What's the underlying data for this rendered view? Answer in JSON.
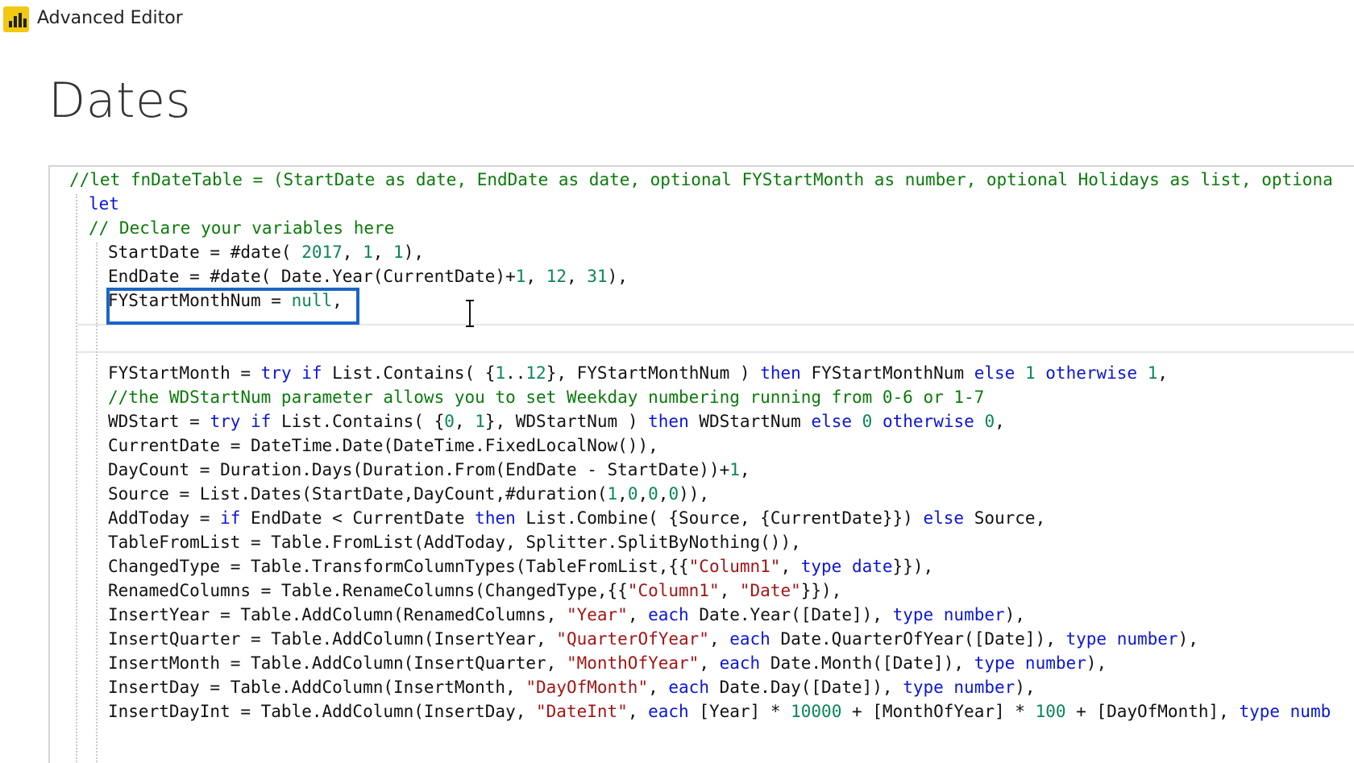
{
  "window": {
    "title": "Advanced Editor",
    "app_icon": "power-bi-icon"
  },
  "query": {
    "name": "Dates"
  },
  "editor": {
    "lines": [
      {
        "indent": 0,
        "segments": [
          {
            "t": "cm",
            "v": "//let fnDateTable = (StartDate as date, EndDate as date, optional FYStartMonth as number, optional Holidays as list, optiona"
          }
        ]
      },
      {
        "indent": 1,
        "segments": [
          {
            "t": "kw",
            "v": "let"
          }
        ]
      },
      {
        "indent": 1,
        "segments": [
          {
            "t": "cm",
            "v": "// Declare your variables here"
          }
        ]
      },
      {
        "indent": 2,
        "segments": [
          {
            "t": "",
            "v": "StartDate = #date( "
          },
          {
            "t": "num",
            "v": "2017"
          },
          {
            "t": "",
            "v": ", "
          },
          {
            "t": "num",
            "v": "1"
          },
          {
            "t": "",
            "v": ", "
          },
          {
            "t": "num",
            "v": "1"
          },
          {
            "t": "",
            "v": "),"
          }
        ]
      },
      {
        "indent": 2,
        "segments": [
          {
            "t": "",
            "v": "EndDate = #date( Date.Year(CurrentDate)+"
          },
          {
            "t": "num",
            "v": "1"
          },
          {
            "t": "",
            "v": ", "
          },
          {
            "t": "num",
            "v": "12"
          },
          {
            "t": "",
            "v": ", "
          },
          {
            "t": "num",
            "v": "31"
          },
          {
            "t": "",
            "v": "),"
          }
        ]
      },
      {
        "indent": 2,
        "segments": [
          {
            "t": "",
            "v": "FYStartMonthNum = "
          },
          {
            "t": "num",
            "v": "null"
          },
          {
            "t": "",
            "v": ","
          }
        ]
      },
      {
        "indent": 2,
        "segments": []
      },
      {
        "indent": 2,
        "segments": []
      },
      {
        "indent": 2,
        "segments": [
          {
            "t": "",
            "v": "FYStartMonth = "
          },
          {
            "t": "kw",
            "v": "try if"
          },
          {
            "t": "",
            "v": " List.Contains( {"
          },
          {
            "t": "num",
            "v": "1"
          },
          {
            "t": "",
            "v": ".."
          },
          {
            "t": "num",
            "v": "12"
          },
          {
            "t": "",
            "v": "}, FYStartMonthNum ) "
          },
          {
            "t": "kw",
            "v": "then"
          },
          {
            "t": "",
            "v": " FYStartMonthNum "
          },
          {
            "t": "kw",
            "v": "else"
          },
          {
            "t": "",
            "v": " "
          },
          {
            "t": "num",
            "v": "1"
          },
          {
            "t": "",
            "v": " "
          },
          {
            "t": "kw",
            "v": "otherwise"
          },
          {
            "t": "",
            "v": " "
          },
          {
            "t": "num",
            "v": "1"
          },
          {
            "t": "",
            "v": ","
          }
        ]
      },
      {
        "indent": 2,
        "segments": [
          {
            "t": "cm",
            "v": "//the WDStartNum parameter allows you to set Weekday numbering running from 0-6 or 1-7"
          }
        ]
      },
      {
        "indent": 2,
        "segments": [
          {
            "t": "",
            "v": "WDStart = "
          },
          {
            "t": "kw",
            "v": "try if"
          },
          {
            "t": "",
            "v": " List.Contains( {"
          },
          {
            "t": "num",
            "v": "0"
          },
          {
            "t": "",
            "v": ", "
          },
          {
            "t": "num",
            "v": "1"
          },
          {
            "t": "",
            "v": "}, WDStartNum ) "
          },
          {
            "t": "kw",
            "v": "then"
          },
          {
            "t": "",
            "v": " WDStartNum "
          },
          {
            "t": "kw",
            "v": "else"
          },
          {
            "t": "",
            "v": " "
          },
          {
            "t": "num",
            "v": "0"
          },
          {
            "t": "",
            "v": " "
          },
          {
            "t": "kw",
            "v": "otherwise"
          },
          {
            "t": "",
            "v": " "
          },
          {
            "t": "num",
            "v": "0"
          },
          {
            "t": "",
            "v": ","
          }
        ]
      },
      {
        "indent": 2,
        "segments": [
          {
            "t": "",
            "v": "CurrentDate = DateTime.Date(DateTime.FixedLocalNow()),"
          }
        ]
      },
      {
        "indent": 2,
        "segments": [
          {
            "t": "",
            "v": "DayCount = Duration.Days(Duration.From(EndDate - StartDate))+"
          },
          {
            "t": "num",
            "v": "1"
          },
          {
            "t": "",
            "v": ","
          }
        ]
      },
      {
        "indent": 2,
        "segments": [
          {
            "t": "",
            "v": "Source = List.Dates(StartDate,DayCount,#duration("
          },
          {
            "t": "num",
            "v": "1"
          },
          {
            "t": "",
            "v": ","
          },
          {
            "t": "num",
            "v": "0"
          },
          {
            "t": "",
            "v": ","
          },
          {
            "t": "num",
            "v": "0"
          },
          {
            "t": "",
            "v": ","
          },
          {
            "t": "num",
            "v": "0"
          },
          {
            "t": "",
            "v": ")),"
          }
        ]
      },
      {
        "indent": 2,
        "segments": [
          {
            "t": "",
            "v": "AddToday = "
          },
          {
            "t": "kw",
            "v": "if"
          },
          {
            "t": "",
            "v": " EndDate < CurrentDate "
          },
          {
            "t": "kw",
            "v": "then"
          },
          {
            "t": "",
            "v": " List.Combine( {Source, {CurrentDate}}) "
          },
          {
            "t": "kw",
            "v": "else"
          },
          {
            "t": "",
            "v": " Source,"
          }
        ]
      },
      {
        "indent": 2,
        "segments": [
          {
            "t": "",
            "v": "TableFromList = Table.FromList(AddToday, Splitter.SplitByNothing()),"
          }
        ]
      },
      {
        "indent": 2,
        "segments": [
          {
            "t": "",
            "v": "ChangedType = Table.TransformColumnTypes(TableFromList,{{"
          },
          {
            "t": "str",
            "v": "\"Column1\""
          },
          {
            "t": "",
            "v": ", "
          },
          {
            "t": "kw",
            "v": "type date"
          },
          {
            "t": "",
            "v": "}}),"
          }
        ]
      },
      {
        "indent": 2,
        "segments": [
          {
            "t": "",
            "v": "RenamedColumns = Table.RenameColumns(ChangedType,{{"
          },
          {
            "t": "str",
            "v": "\"Column1\""
          },
          {
            "t": "",
            "v": ", "
          },
          {
            "t": "str",
            "v": "\"Date\""
          },
          {
            "t": "",
            "v": "}}),"
          }
        ]
      },
      {
        "indent": 2,
        "segments": [
          {
            "t": "",
            "v": "InsertYear = Table.AddColumn(RenamedColumns, "
          },
          {
            "t": "str",
            "v": "\"Year\""
          },
          {
            "t": "",
            "v": ", "
          },
          {
            "t": "kw",
            "v": "each"
          },
          {
            "t": "",
            "v": " Date.Year([Date]), "
          },
          {
            "t": "kw",
            "v": "type number"
          },
          {
            "t": "",
            "v": "),"
          }
        ]
      },
      {
        "indent": 2,
        "segments": [
          {
            "t": "",
            "v": "InsertQuarter = Table.AddColumn(InsertYear, "
          },
          {
            "t": "str",
            "v": "\"QuarterOfYear\""
          },
          {
            "t": "",
            "v": ", "
          },
          {
            "t": "kw",
            "v": "each"
          },
          {
            "t": "",
            "v": " Date.QuarterOfYear([Date]), "
          },
          {
            "t": "kw",
            "v": "type number"
          },
          {
            "t": "",
            "v": "),"
          }
        ]
      },
      {
        "indent": 2,
        "segments": [
          {
            "t": "",
            "v": "InsertMonth = Table.AddColumn(InsertQuarter, "
          },
          {
            "t": "str",
            "v": "\"MonthOfYear\""
          },
          {
            "t": "",
            "v": ", "
          },
          {
            "t": "kw",
            "v": "each"
          },
          {
            "t": "",
            "v": " Date.Month([Date]), "
          },
          {
            "t": "kw",
            "v": "type number"
          },
          {
            "t": "",
            "v": "),"
          }
        ]
      },
      {
        "indent": 2,
        "segments": [
          {
            "t": "",
            "v": "InsertDay = Table.AddColumn(InsertMonth, "
          },
          {
            "t": "str",
            "v": "\"DayOfMonth\""
          },
          {
            "t": "",
            "v": ", "
          },
          {
            "t": "kw",
            "v": "each"
          },
          {
            "t": "",
            "v": " Date.Day([Date]), "
          },
          {
            "t": "kw",
            "v": "type number"
          },
          {
            "t": "",
            "v": "),"
          }
        ]
      },
      {
        "indent": 2,
        "segments": [
          {
            "t": "",
            "v": "InsertDayInt = Table.AddColumn(InsertDay, "
          },
          {
            "t": "str",
            "v": "\"DateInt\""
          },
          {
            "t": "",
            "v": ", "
          },
          {
            "t": "kw",
            "v": "each"
          },
          {
            "t": "",
            "v": " [Year] * "
          },
          {
            "t": "num",
            "v": "10000"
          },
          {
            "t": "",
            "v": " + [MonthOfYear] * "
          },
          {
            "t": "num",
            "v": "100"
          },
          {
            "t": "",
            "v": " + [DayOfMonth], "
          },
          {
            "t": "kw",
            "v": "type numb"
          }
        ]
      }
    ],
    "highlighted_line": 5,
    "cursor_icon": "text-cursor-icon"
  },
  "colors": {
    "keyword": "#0b16d8",
    "number": "#098658",
    "string": "#a31515",
    "comment": "#0a7a0a",
    "highlight_box": "#1c64c8"
  }
}
